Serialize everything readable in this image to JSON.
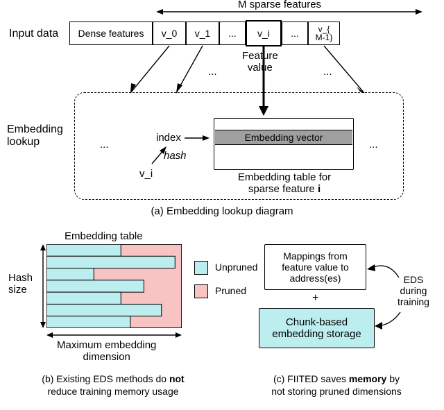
{
  "top": {
    "input_data_label": "Input data",
    "m_sparse_label": "M sparse features",
    "cells": {
      "dense": "Dense features",
      "v0": "v_0",
      "v1": "v_1",
      "ell1": "...",
      "vi": "v_i",
      "ell2": "...",
      "vm1": "v_{\nM-1}"
    },
    "feature_value_label": "Feature\nvalue",
    "embedding_lookup_label": "Embedding\nlookup",
    "ellipsis_top": "...",
    "ellipsis_left": "...",
    "ellipsis_right": "...",
    "ellipsis_right2": "...",
    "index_label": "index",
    "hash_label": "hash",
    "vi_label": "v_i",
    "embedding_vector_label": "Embedding vector",
    "table_caption": "Embedding table for\nsparse feature",
    "table_caption_bold": "i",
    "caption_a": "(a) Embedding lookup diagram"
  },
  "left": {
    "embedding_table_label": "Embedding table",
    "hash_size_label": "Hash\nsize",
    "max_dim_label": "Maximum embedding\ndimension",
    "legend_unpruned": "Unpruned",
    "legend_pruned": "Pruned",
    "caption_b_line1": "(b) Existing EDS methods do",
    "caption_b_bold": "not",
    "caption_b_line2": "reduce training memory usage",
    "colors": {
      "unpruned": "#bceeef",
      "pruned": "#f7c3c3"
    },
    "bar_fractions": [
      0.55,
      0.95,
      0.35,
      0.72,
      0.55,
      0.85,
      0.62
    ]
  },
  "right": {
    "mappings_label": "Mappings from\nfeature value to\naddress(es)",
    "plus_label": "+",
    "chunk_label": "Chunk-based\nembedding storage",
    "eds_label": "EDS\nduring\ntraining",
    "caption_c_line1": "(c) FIITED saves",
    "caption_c_bold": "memory",
    "caption_c_line2": "by\nnot storing pruned dimensions",
    "colors": {
      "chunk_bg": "#bceeef"
    }
  }
}
